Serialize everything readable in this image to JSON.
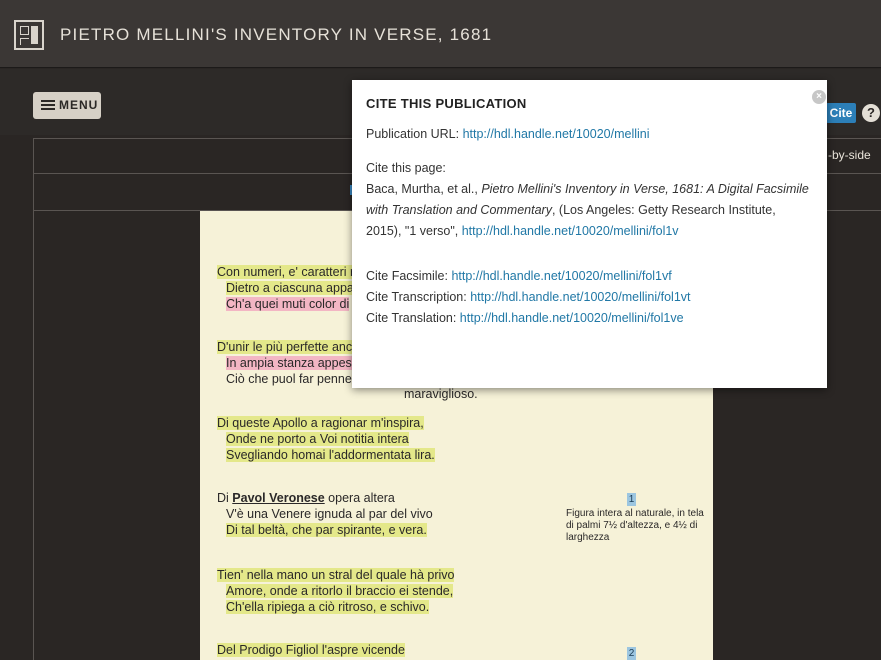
{
  "app": {
    "title": "PIETRO MELLINI'S INVENTORY IN VERSE, 1681"
  },
  "toolbar": {
    "menu_label": "MENU",
    "cite_label": "Cite",
    "help_label": "?",
    "view_label": "-by-side"
  },
  "popup": {
    "heading": "CITE THIS PUBLICATION",
    "close_label": "×",
    "pub_url_label": "Publication URL: ",
    "pub_url": "http://hdl.handle.net/10020/mellini",
    "cite_page_label": "Cite this page:",
    "citation_authors": "Baca, Murtha, et al., ",
    "citation_title": "Pietro Mellini's Inventory in Verse, 1681: A Digital Facsimile with Translation and Commentary",
    "citation_pub": ", (Los Angeles: Getty Research Institute, 2015), \"1 verso\", ",
    "citation_url": "http://hdl.handle.net/10020/mellini/fol1v",
    "facsimile_label": "Cite Facsimile: ",
    "facsimile_url": "http://hdl.handle.net/10020/mellini/fol1vf",
    "transcription_label": "Cite Transcription: ",
    "transcription_url": "http://hdl.handle.net/10020/mellini/fol1vt",
    "translation_label": "Cite Translation: ",
    "translation_url": "http://hdl.handle.net/10020/mellini/fol1ve"
  },
  "poem": {
    "s1": [
      "Con numeri, e' caratteri r",
      "Dietro a ciascuna appa",
      "Ch'a quei muti color di"
    ],
    "s2": [
      "D'unir le più perfette anc",
      "In ampia stanza appese",
      "Ciò che puol far pennel"
    ],
    "s2_tail": "maraviglioso.",
    "s3": [
      "Di queste Apollo a ragionar m'inspira,",
      "Onde ne porto a Voi notitia intera",
      "Svegliando homai l'addormentata lira."
    ],
    "s4a_prefix": "Di ",
    "s4a_name": "Pavol Veronese",
    "s4a_suffix": " opera altera",
    "s4": [
      "V'è una Venere ignuda al par del vivo",
      "Di tal beltà, che par spirante, e vera."
    ],
    "s5": [
      "Tien' nella mano un stral del quale hà privo",
      "Amore, onde a ritorlo il braccio ei stende,",
      "Ch'ella ripiega a ciò ritroso, e schivo."
    ],
    "s6": [
      "Del Prodigo Figliol l'aspre vicende"
    ],
    "note1_num": "1",
    "note1_text": "Figura intera al naturale, in tela di palmi 7½ d'altezza, e 4½ di larghezza",
    "note2_num": "2"
  }
}
